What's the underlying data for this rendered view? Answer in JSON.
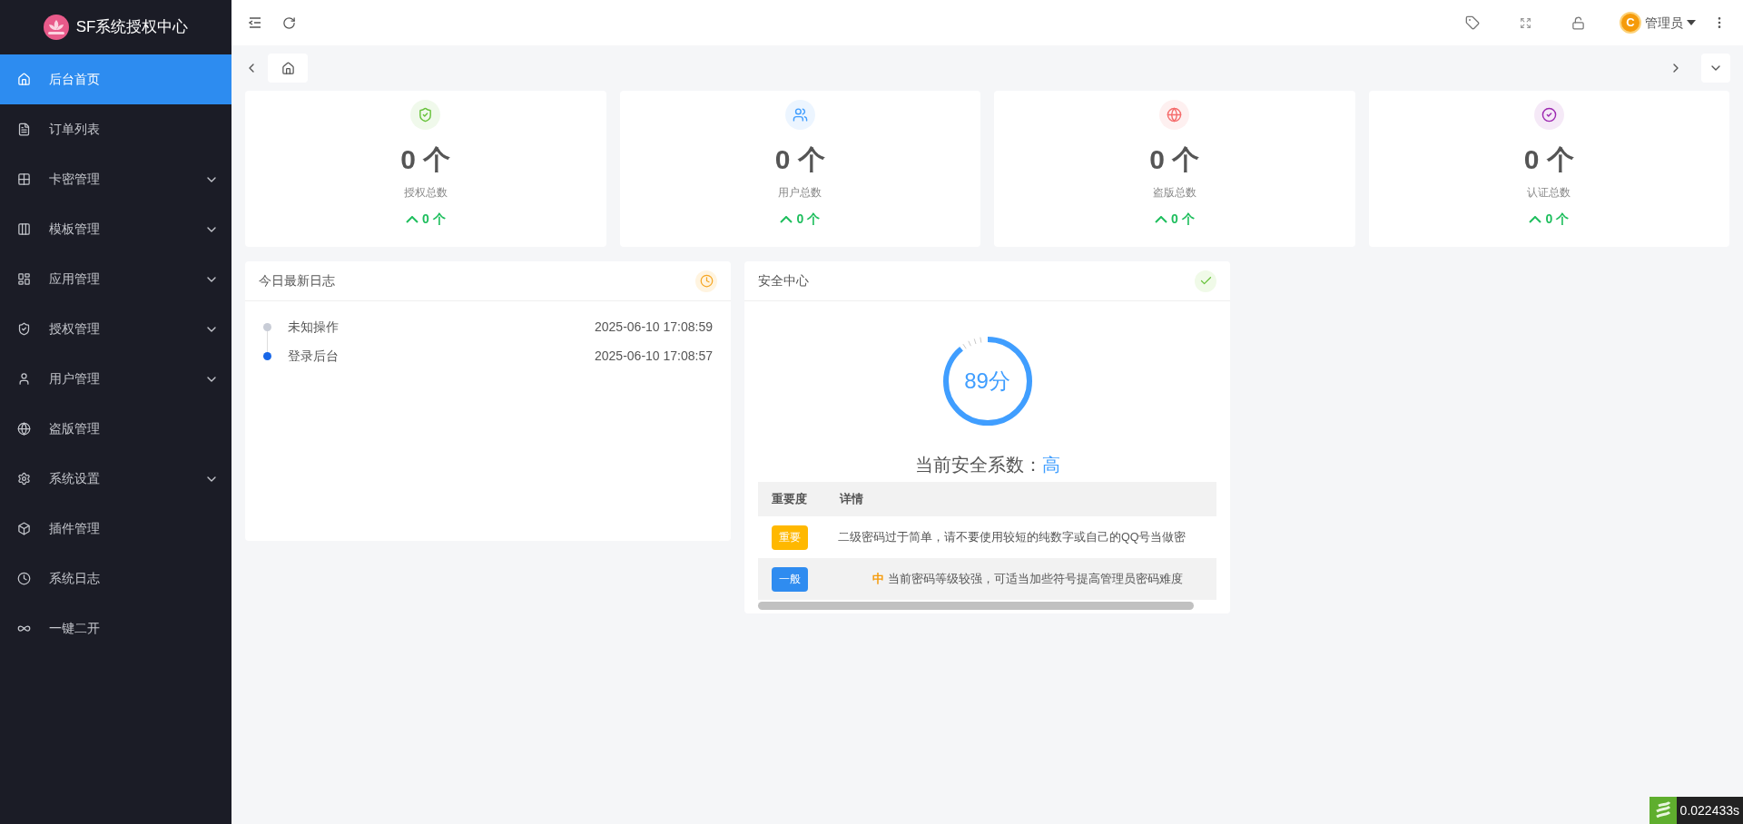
{
  "brand": {
    "title": "SF系统授权中心"
  },
  "sidebar": {
    "items": [
      {
        "label": "后台首页",
        "expandable": false,
        "selected": true
      },
      {
        "label": "订单列表",
        "expandable": false,
        "selected": false
      },
      {
        "label": "卡密管理",
        "expandable": true,
        "selected": false
      },
      {
        "label": "模板管理",
        "expandable": true,
        "selected": false
      },
      {
        "label": "应用管理",
        "expandable": true,
        "selected": false
      },
      {
        "label": "授权管理",
        "expandable": true,
        "selected": false
      },
      {
        "label": "用户管理",
        "expandable": true,
        "selected": false
      },
      {
        "label": "盗版管理",
        "expandable": false,
        "selected": false
      },
      {
        "label": "系统设置",
        "expandable": true,
        "selected": false
      },
      {
        "label": "插件管理",
        "expandable": false,
        "selected": false
      },
      {
        "label": "系统日志",
        "expandable": false,
        "selected": false
      },
      {
        "label": "一键二开",
        "expandable": false,
        "selected": false
      }
    ]
  },
  "header": {
    "user": {
      "name": "管理员",
      "avatar_letter": "C"
    }
  },
  "stats": [
    {
      "color": "#67c23a",
      "value": "0 个",
      "label": "授权总数",
      "delta": "0 个"
    },
    {
      "color": "#409eff",
      "value": "0 个",
      "label": "用户总数",
      "delta": "0 个"
    },
    {
      "color": "#f56c6c",
      "value": "0 个",
      "label": "盗版总数",
      "delta": "0 个"
    },
    {
      "color": "#9c27b0",
      "value": "0 个",
      "label": "认证总数",
      "delta": "0 个"
    }
  ],
  "log_panel": {
    "title": "今日最新日志",
    "items": [
      {
        "text": "未知操作",
        "time": "2025-06-10 17:08:59",
        "color": "#c8ccd6"
      },
      {
        "text": "登录后台",
        "time": "2025-06-10 17:08:57",
        "color": "#1867e8"
      }
    ]
  },
  "security_panel": {
    "title": "安全中心",
    "score": {
      "text": "89分",
      "level": 0.89
    },
    "rating_label": "当前安全系数：",
    "rating": "高",
    "table": {
      "columns": [
        "重要度",
        "详情"
      ],
      "rows": [
        {
          "badge": "重要",
          "color": "#ffb800",
          "level_text": null,
          "detail": "二级密码过于简单，请不要使用较短的纯数字或自己的QQ号当做密"
        },
        {
          "badge": "一般",
          "color": "#2f8cf0",
          "level_text": "中",
          "detail": "当前密码等级较强，可适当加些符号提高管理员密码难度"
        }
      ]
    }
  },
  "debug_timer": "0.022433s"
}
